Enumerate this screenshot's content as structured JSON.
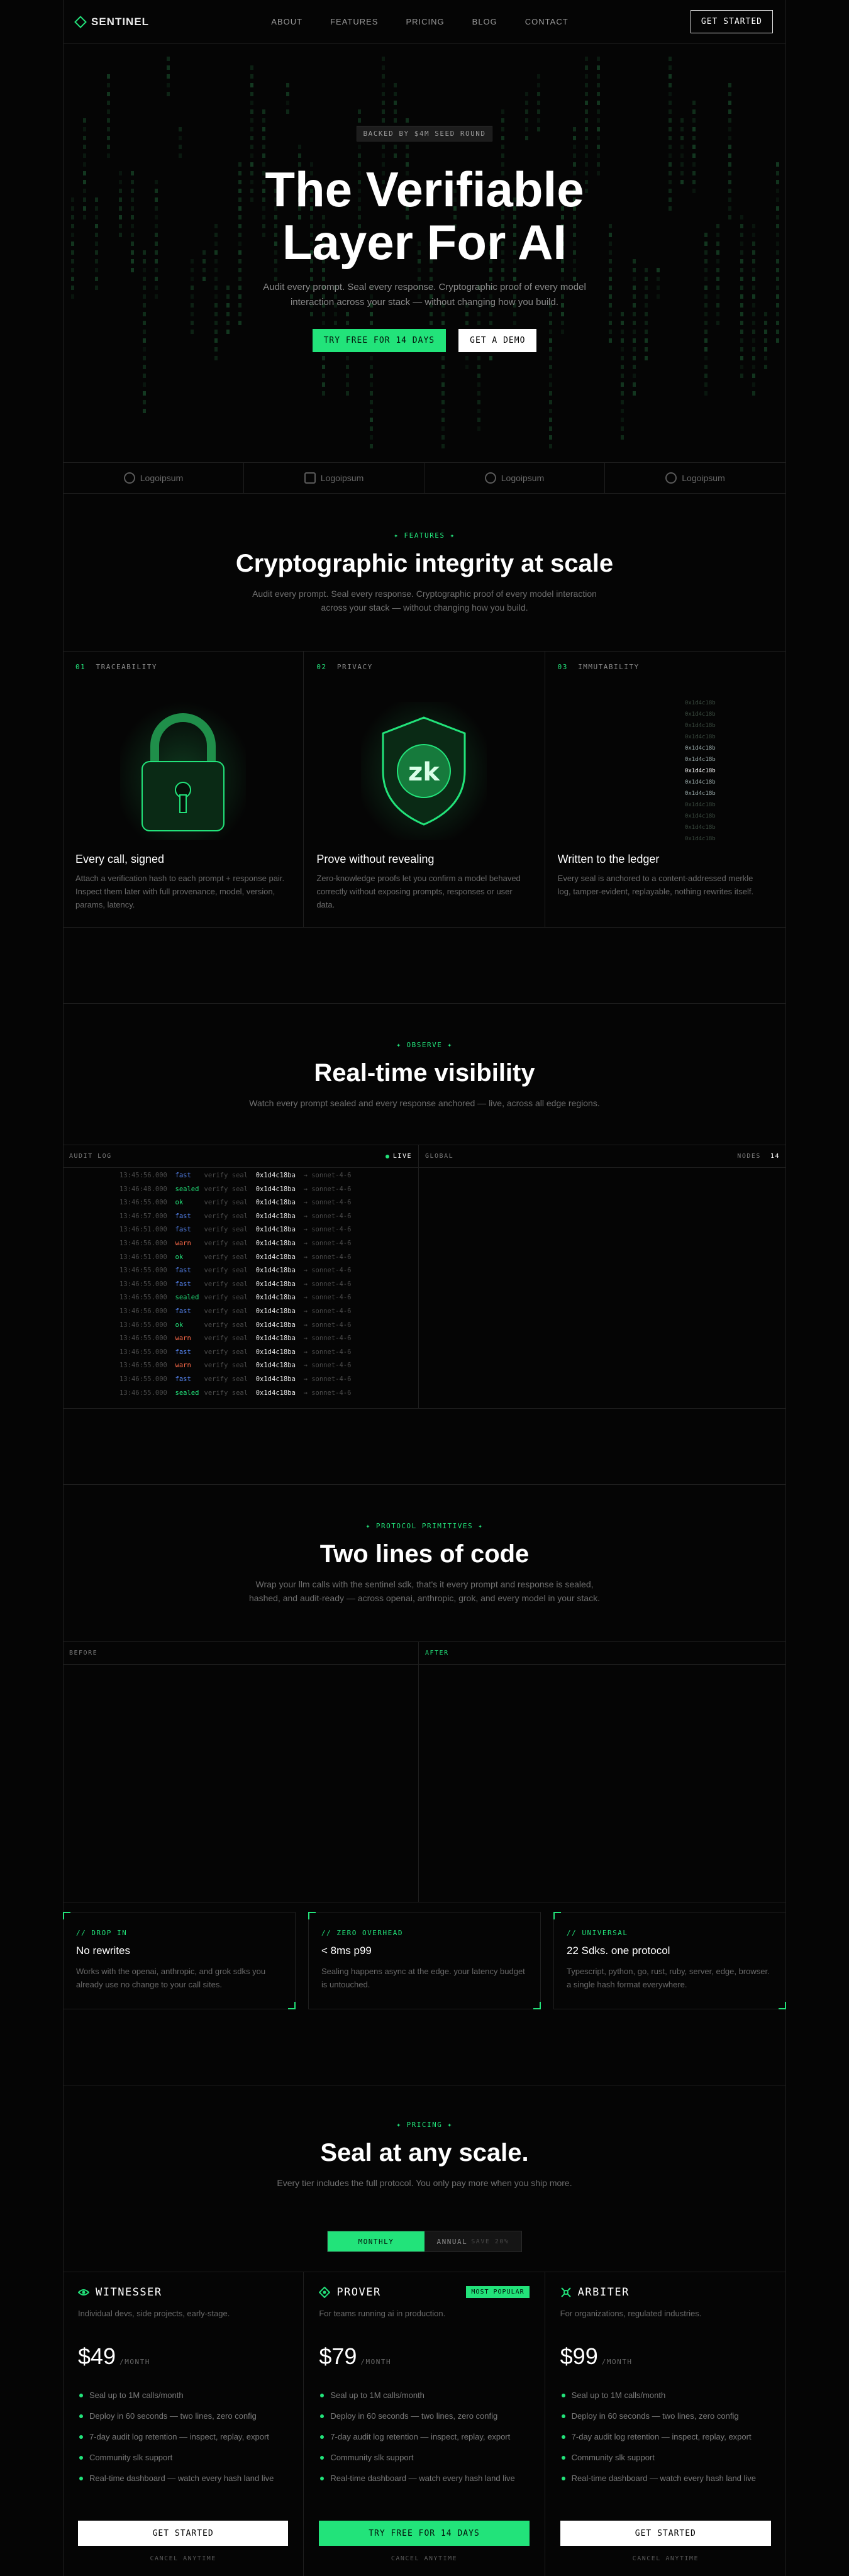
{
  "nav": {
    "brand": "SENTINEL",
    "links": [
      "ABOUT",
      "FEATURES",
      "PRICING",
      "BLOG",
      "CONTACT"
    ],
    "cta": "GET STARTED"
  },
  "hero": {
    "pill": "BACKED BY $4M SEED ROUND",
    "title_l1": "The Verifiable",
    "title_l2": "Layer For AI",
    "subtitle": "Audit every prompt. Seal every response. Cryptographic proof of every model interaction across your stack — without changing how you build.",
    "cta_primary": "TRY FREE FOR 14 DAYS",
    "cta_secondary": "GET A DEMO"
  },
  "logos": [
    "Logoipsum",
    "Logoipsum",
    "Logoipsum",
    "Logoipsum"
  ],
  "features": {
    "tag": "✦ FEATURES ✦",
    "title": "Cryptographic integrity at scale",
    "subtitle": "Audit every prompt. Seal every response. Cryptographic proof of every model interaction across your stack — without changing how you build.",
    "cards": [
      {
        "num": "01",
        "label": "TRACEABILITY",
        "title": "Every call, signed",
        "body": "Attach a verification hash to each prompt + response pair. Inspect them later with full provenance, model, version, params, latency."
      },
      {
        "num": "02",
        "label": "PRIVACY",
        "title": "Prove without revealing",
        "body": "Zero-knowledge proofs let you confirm a model behaved correctly without exposing prompts, responses or user data.",
        "badge": "zk"
      },
      {
        "num": "03",
        "label": "IMMUTABILITY",
        "title": "Written to the ledger",
        "body": "Every seal is anchored to a content-addressed merkle log, tamper-evident, replayable, nothing rewrites itself.",
        "ledger": [
          "0x1d4c18b",
          "0x1d4c18b",
          "0x1d4c18b",
          "0x1d4c18b",
          "0x1d4c18b",
          "0x1d4c18b",
          "0x1d4c18b",
          "0x1d4c18b",
          "0x1d4c18b",
          "0x1d4c18b",
          "0x1d4c18b",
          "0x1d4c18b",
          "0x1d4c18b"
        ]
      }
    ]
  },
  "observe": {
    "tag": "✦ OBSERVE ✦",
    "title": "Real-time visibility",
    "subtitle": "Watch every prompt sealed and every response anchored — live, across all edge regions.",
    "audit_label": "AUDIT LOG",
    "live": "LIVE",
    "global_label": "GLOBAL",
    "nodes_label": "NODES",
    "nodes_count": "14",
    "rows": [
      {
        "t": "13:45:56.000",
        "s": "fast",
        "c": "#5a8cff"
      },
      {
        "t": "13:46:48.000",
        "s": "sealed",
        "c": "#22e37a"
      },
      {
        "t": "13:46:55.000",
        "s": "ok",
        "c": "#22e37a"
      },
      {
        "t": "13:46:57.000",
        "s": "fast",
        "c": "#5a8cff"
      },
      {
        "t": "13:46:51.000",
        "s": "fast",
        "c": "#5a8cff"
      },
      {
        "t": "13:46:56.000",
        "s": "warn",
        "c": "#ff6b4a"
      },
      {
        "t": "13:46:51.000",
        "s": "ok",
        "c": "#22e37a"
      },
      {
        "t": "13:46:55.000",
        "s": "fast",
        "c": "#5a8cff"
      },
      {
        "t": "13:46:55.000",
        "s": "fast",
        "c": "#5a8cff"
      },
      {
        "t": "13:46:55.000",
        "s": "sealed",
        "c": "#22e37a"
      },
      {
        "t": "13:46:56.000",
        "s": "fast",
        "c": "#5a8cff"
      },
      {
        "t": "13:46:55.000",
        "s": "ok",
        "c": "#22e37a"
      },
      {
        "t": "13:46:55.000",
        "s": "warn",
        "c": "#ff6b4a"
      },
      {
        "t": "13:46:55.000",
        "s": "fast",
        "c": "#5a8cff"
      },
      {
        "t": "13:46:55.000",
        "s": "warn",
        "c": "#ff6b4a"
      },
      {
        "t": "13:46:55.000",
        "s": "fast",
        "c": "#5a8cff"
      },
      {
        "t": "13:46:55.000",
        "s": "sealed",
        "c": "#22e37a"
      }
    ],
    "row_verb": "verify seal",
    "row_hash": "0x1d4c18ba",
    "row_tail": "→ sonnet-4-6"
  },
  "code": {
    "tag": "✦ PROTOCOL PRIMITIVES ✦",
    "title": "Two lines of code",
    "subtitle": "Wrap your llm calls with the sentinel sdk, that's it every prompt and response is sealed, hashed, and audit-ready — across openai, anthropic, grok, and every model in your stack.",
    "before": "BEFORE",
    "after": "AFTER",
    "props": [
      {
        "tag": "// DROP IN",
        "title": "No rewrites",
        "body": "Works with the openai, anthropic, and grok sdks you already use no change to your call sites."
      },
      {
        "tag": "// ZERO OVERHEAD",
        "title": "< 8ms p99",
        "body": "Sealing happens async at the edge. your latency budget is untouched."
      },
      {
        "tag": "// UNIVERSAL",
        "title": "22 Sdks. one protocol",
        "body": "Typescript, python, go, rust, ruby, server, edge, browser. a single hash format everywhere."
      }
    ]
  },
  "pricing": {
    "tag": "✦ PRICING ✦",
    "title": "Seal at any scale.",
    "subtitle": "Every tier includes the full protocol. You only pay more when you ship more.",
    "monthly": "MONTHLY",
    "annual": "ANNUAL",
    "annual_note": "SAVE 20%",
    "plans": [
      {
        "name": "WITNESSER",
        "sub": "Individual devs, side projects, early-stage.",
        "price": "$49",
        "per": "/MONTH",
        "features": [
          "Seal up to 1M calls/month",
          "Deploy in 60 seconds — two lines, zero config",
          "7-day audit log retention — inspect, replay, export",
          "Community slk support",
          "Real-time dashboard — watch every hash land live"
        ],
        "cta": "GET STARTED",
        "cancel": "CANCEL ANYTIME"
      },
      {
        "name": "PROVER",
        "badge": "MOST POPULAR",
        "sub": "For teams running ai in production.",
        "price": "$79",
        "per": "/MONTH",
        "features": [
          "Seal up to 1M calls/month",
          "Deploy in 60 seconds — two lines, zero config",
          "7-day audit log retention — inspect, replay, export",
          "Community slk support",
          "Real-time dashboard — watch every hash land live"
        ],
        "cta": "TRY FREE FOR 14 DAYS",
        "cancel": "CANCEL ANYTIME"
      },
      {
        "name": "ARBITER",
        "sub": "For organizations, regulated industries.",
        "price": "$99",
        "per": "/MONTH",
        "features": [
          "Seal up to 1M calls/month",
          "Deploy in 60 seconds — two lines, zero config",
          "7-day audit log retention — inspect, replay, export",
          "Community slk support",
          "Real-time dashboard — watch every hash land live"
        ],
        "cta": "GET STARTED",
        "cancel": "CANCEL ANYTIME"
      }
    ]
  },
  "colors": {
    "accent": "#22e37a",
    "bg": "#050505",
    "border": "#1f1f1f"
  }
}
